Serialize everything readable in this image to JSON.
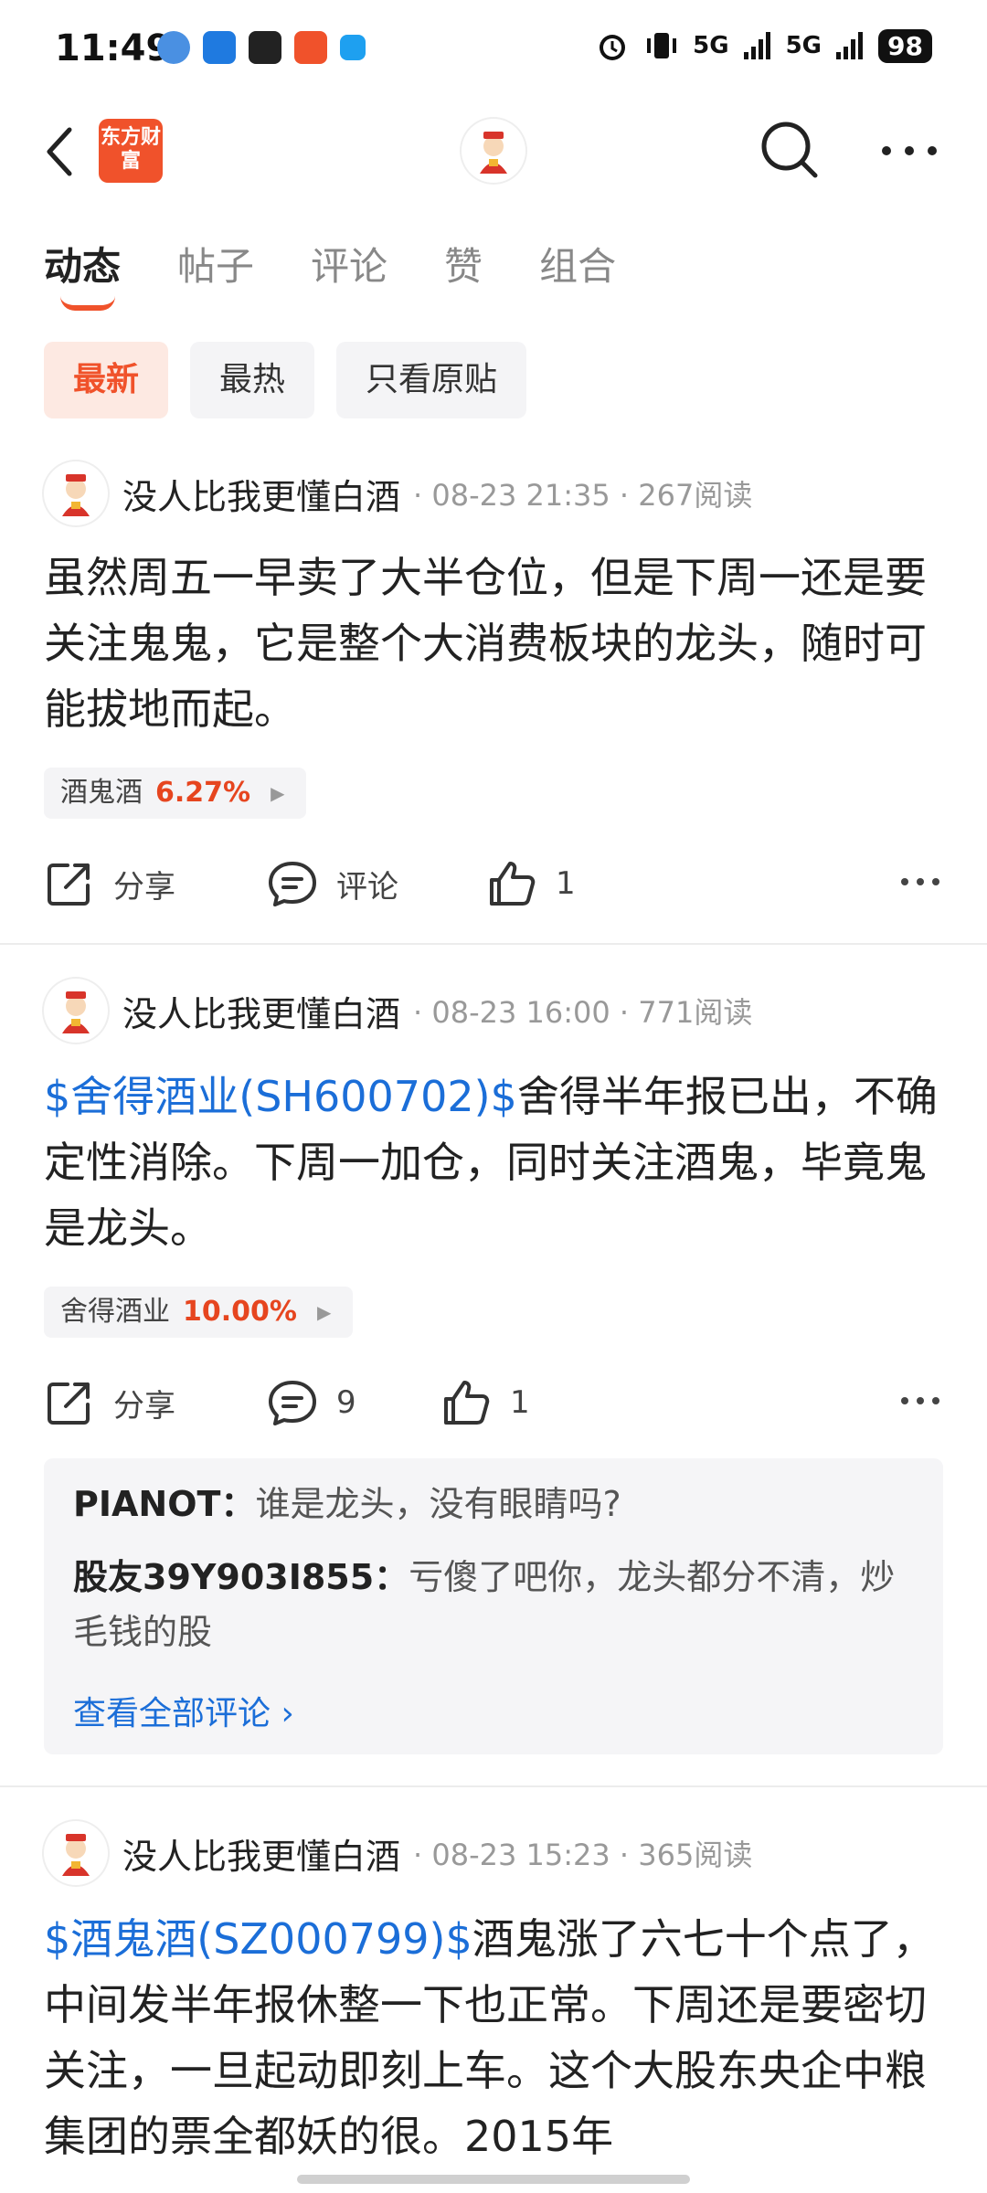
{
  "status_bar": {
    "time": "11:49",
    "signal_1": "5G",
    "signal_2": "5G",
    "battery": "98"
  },
  "header": {
    "logo_text": "东方财富"
  },
  "tabs": [
    {
      "label": "动态",
      "active": true
    },
    {
      "label": "帖子",
      "active": false
    },
    {
      "label": "评论",
      "active": false
    },
    {
      "label": "赞",
      "active": false
    },
    {
      "label": "组合",
      "active": false
    }
  ],
  "filters": [
    {
      "label": "最新",
      "active": true
    },
    {
      "label": "最热",
      "active": false
    },
    {
      "label": "只看原贴",
      "active": false
    }
  ],
  "posts": [
    {
      "author": "没人比我更懂白酒",
      "meta": "· 08-23 21:35 · 267阅读",
      "stock_prefix": "",
      "text": "虽然周五一早卖了大半仓位，但是下周一还是要关注鬼鬼，它是整个大消费板块的龙头，随时可能拔地而起。",
      "chip_name": "酒鬼酒",
      "chip_change": "6.27%",
      "share_label": "分享",
      "comment_label": "评论",
      "like_count": "1"
    },
    {
      "author": "没人比我更懂白酒",
      "meta": "· 08-23 16:00 · 771阅读",
      "stock_prefix": "$舍得酒业(SH600702)$",
      "text": "舍得半年报已出，不确定性消除。下周一加仓，同时关注酒鬼，毕竟鬼是龙头。",
      "chip_name": "舍得酒业",
      "chip_change": "10.00%",
      "share_label": "分享",
      "comment_label": "9",
      "like_count": "1",
      "comments": [
        {
          "user": "PIANOT：",
          "text": "谁是龙头，没有眼睛吗?"
        },
        {
          "user": "股友39Y903I855：",
          "text": "亏傻了吧你，龙头都分不清，炒毛钱的股"
        }
      ],
      "view_all": "查看全部评论 ›"
    },
    {
      "author": "没人比我更懂白酒",
      "meta": "· 08-23 15:23 · 365阅读",
      "stock_prefix": "$酒鬼酒(SZ000799)$",
      "text": "酒鬼涨了六七十个点了，中间发半年报休整一下也正常。下周还是要密切关注，一旦起动即刻上车。这个大股东央企中粮集团的票全都妖的很。2015年"
    }
  ],
  "colors": {
    "accent": "#f0522b",
    "link": "#1b6ed8",
    "up": "#e6451f"
  }
}
